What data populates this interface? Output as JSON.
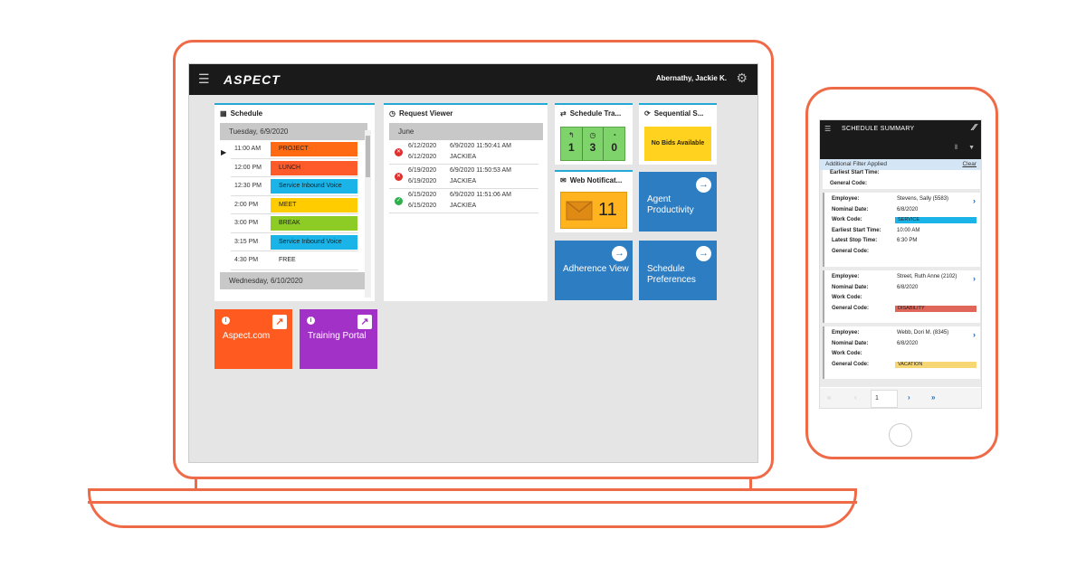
{
  "header": {
    "app_logo": "ASPECT",
    "user_name": "Abernathy, Jackie K.",
    "menu_icon": "hamburger-icon",
    "settings_icon": "gear-icon"
  },
  "schedule": {
    "title": "Schedule",
    "day1": "Tuesday, 6/9/2020",
    "rows": [
      {
        "time": "11:00 AM",
        "activity": "PROJECT",
        "color": "#ff6a13"
      },
      {
        "time": "12:00 PM",
        "activity": "LUNCH",
        "color": "#ff5a2a"
      },
      {
        "time": "12:30 PM",
        "activity": "Service Inbound Voice",
        "color": "#1ab4e8"
      },
      {
        "time": "2:00 PM",
        "activity": "MEET",
        "color": "#ffcc00"
      },
      {
        "time": "3:00 PM",
        "activity": "BREAK",
        "color": "#8ccc25"
      },
      {
        "time": "3:15 PM",
        "activity": "Service Inbound Voice",
        "color": "#1ab4e8"
      },
      {
        "time": "4:30 PM",
        "activity": "FREE",
        "color": "#ffffff"
      }
    ],
    "day2": "Wednesday, 6/10/2020"
  },
  "request_viewer": {
    "title": "Request Viewer",
    "month": "June",
    "rows": [
      {
        "date1": "6/12/2020",
        "date2": "6/12/2020",
        "created": "6/9/2020 11:50:41 AM",
        "user": "JACKIEA",
        "status": "denied"
      },
      {
        "date1": "6/19/2020",
        "date2": "6/19/2020",
        "created": "6/9/2020 11:50:53 AM",
        "user": "JACKIEA",
        "status": "denied"
      },
      {
        "date1": "6/15/2020",
        "date2": "6/15/2020",
        "created": "6/9/2020 11:51:06 AM",
        "user": "JACKIEA",
        "status": "approved"
      }
    ]
  },
  "schedule_trade": {
    "title": "Schedule Tra...",
    "counts": [
      "1",
      "3",
      "0"
    ]
  },
  "sequential": {
    "title": "Sequential S...",
    "message": "No Bids Available"
  },
  "web_notifications": {
    "title": "Web Notificat...",
    "count": "11"
  },
  "tiles": {
    "agent_productivity": "Agent Productivity",
    "adherence_view": "Adherence View",
    "schedule_preferences": "Schedule Preferences"
  },
  "links": {
    "aspect": "Aspect.com",
    "training": "Training Portal"
  },
  "colors": {
    "accent": "#24a9d6",
    "tile_blue": "#2d7dc3",
    "orange": "#ff5a1f",
    "purple": "#a232c7",
    "frame": "#ef6a47"
  },
  "phone": {
    "title": "SCHEDULE SUMMARY",
    "filter_text": "Additional Filter Applied",
    "clear": "Clear",
    "partial": {
      "k1": "Earliest Start Time:",
      "k2": "General Code:"
    },
    "cards": [
      {
        "employee": "Stevens, Sally (5583)",
        "nominal_date": "6/8/2020",
        "work_code": "SERVICE",
        "work_color": "#1ab4e8",
        "earliest": "10:00 AM",
        "latest": "6:30 PM",
        "general_code": ""
      },
      {
        "employee": "Street, Ruth Anne (2102)",
        "nominal_date": "6/8/2020",
        "work_code": "",
        "general_code": "DISABILITY",
        "gen_color": "#e0665a"
      },
      {
        "employee": "Webb, Dori M. (8345)",
        "nominal_date": "6/8/2020",
        "work_code": "",
        "general_code": "VACATION",
        "gen_color": "#f7d774"
      }
    ],
    "labels": {
      "employee": "Employee:",
      "nominal": "Nominal Date:",
      "work": "Work Code:",
      "earliest": "Earliest Start Time:",
      "latest": "Latest Stop Time:",
      "general": "General Code:"
    },
    "page": "1"
  }
}
